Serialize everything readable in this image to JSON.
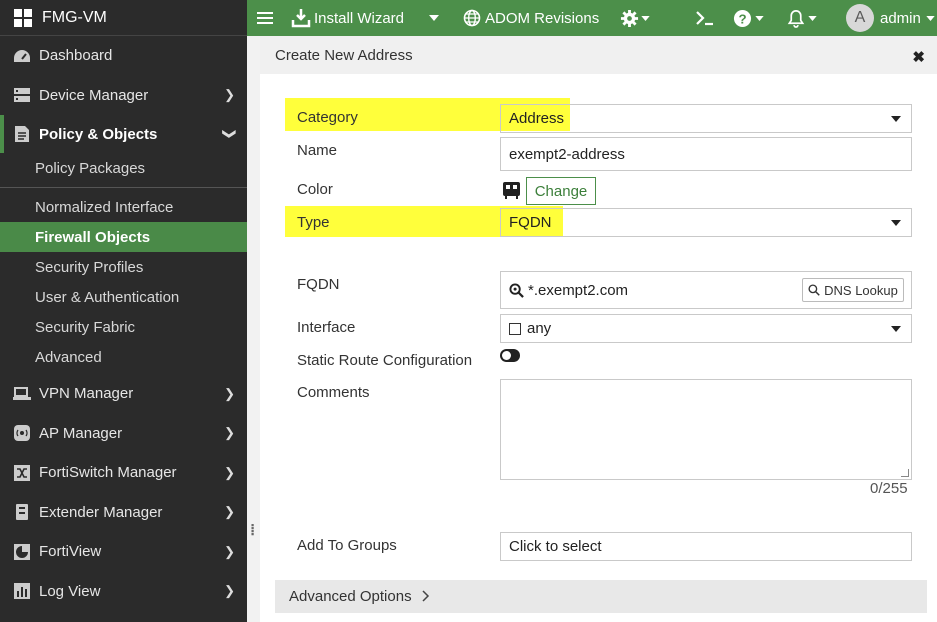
{
  "sidebar": {
    "brand": "FMG-VM",
    "items_top": [
      {
        "label": "Dashboard",
        "icon": "dashboard-icon"
      },
      {
        "label": "Device Manager",
        "icon": "device-manager-icon"
      }
    ],
    "active": {
      "label": "Policy & Objects",
      "icon": "policy-objects-icon"
    },
    "sub_items": [
      {
        "label": "Policy Packages"
      },
      {
        "label": "Normalized Interface"
      },
      {
        "label": "Firewall Objects"
      },
      {
        "label": "Security Profiles"
      },
      {
        "label": "User & Authentication"
      },
      {
        "label": "Security Fabric"
      },
      {
        "label": "Advanced"
      }
    ],
    "items_bottom": [
      {
        "label": "VPN Manager",
        "icon": "vpn-manager-icon"
      },
      {
        "label": "AP Manager",
        "icon": "ap-manager-icon"
      },
      {
        "label": "FortiSwitch Manager",
        "icon": "fortiswitch-icon"
      },
      {
        "label": "Extender Manager",
        "icon": "extender-icon"
      },
      {
        "label": "FortiView",
        "icon": "fortiview-icon"
      },
      {
        "label": "Log View",
        "icon": "log-view-icon"
      }
    ]
  },
  "topbar": {
    "install_wizard": "Install Wizard",
    "adom_revisions": "ADOM Revisions",
    "avatar_letter": "A",
    "user": "admin"
  },
  "dialog": {
    "title": "Create New Address",
    "close": "✖",
    "category_label": "Category",
    "category_value": "Address",
    "name_label": "Name",
    "name_value": "exempt2-address",
    "color_label": "Color",
    "change_label": "Change",
    "type_label": "Type",
    "type_value": "FQDN",
    "fqdn_label": "FQDN",
    "fqdn_value": "*.exempt2.com",
    "dns_lookup": "DNS Lookup",
    "interface_label": "Interface",
    "interface_value": "any",
    "static_route_label": "Static Route Configuration",
    "comments_label": "Comments",
    "comments_counter": "0/255",
    "groups_label": "Add To Groups",
    "groups_placeholder": "Click to select",
    "advanced_options": "Advanced Options"
  },
  "colors": {
    "sidebar_bg": "#2b2b2b",
    "accent_green": "#4c8f4a",
    "highlight": "#ffff3b"
  }
}
